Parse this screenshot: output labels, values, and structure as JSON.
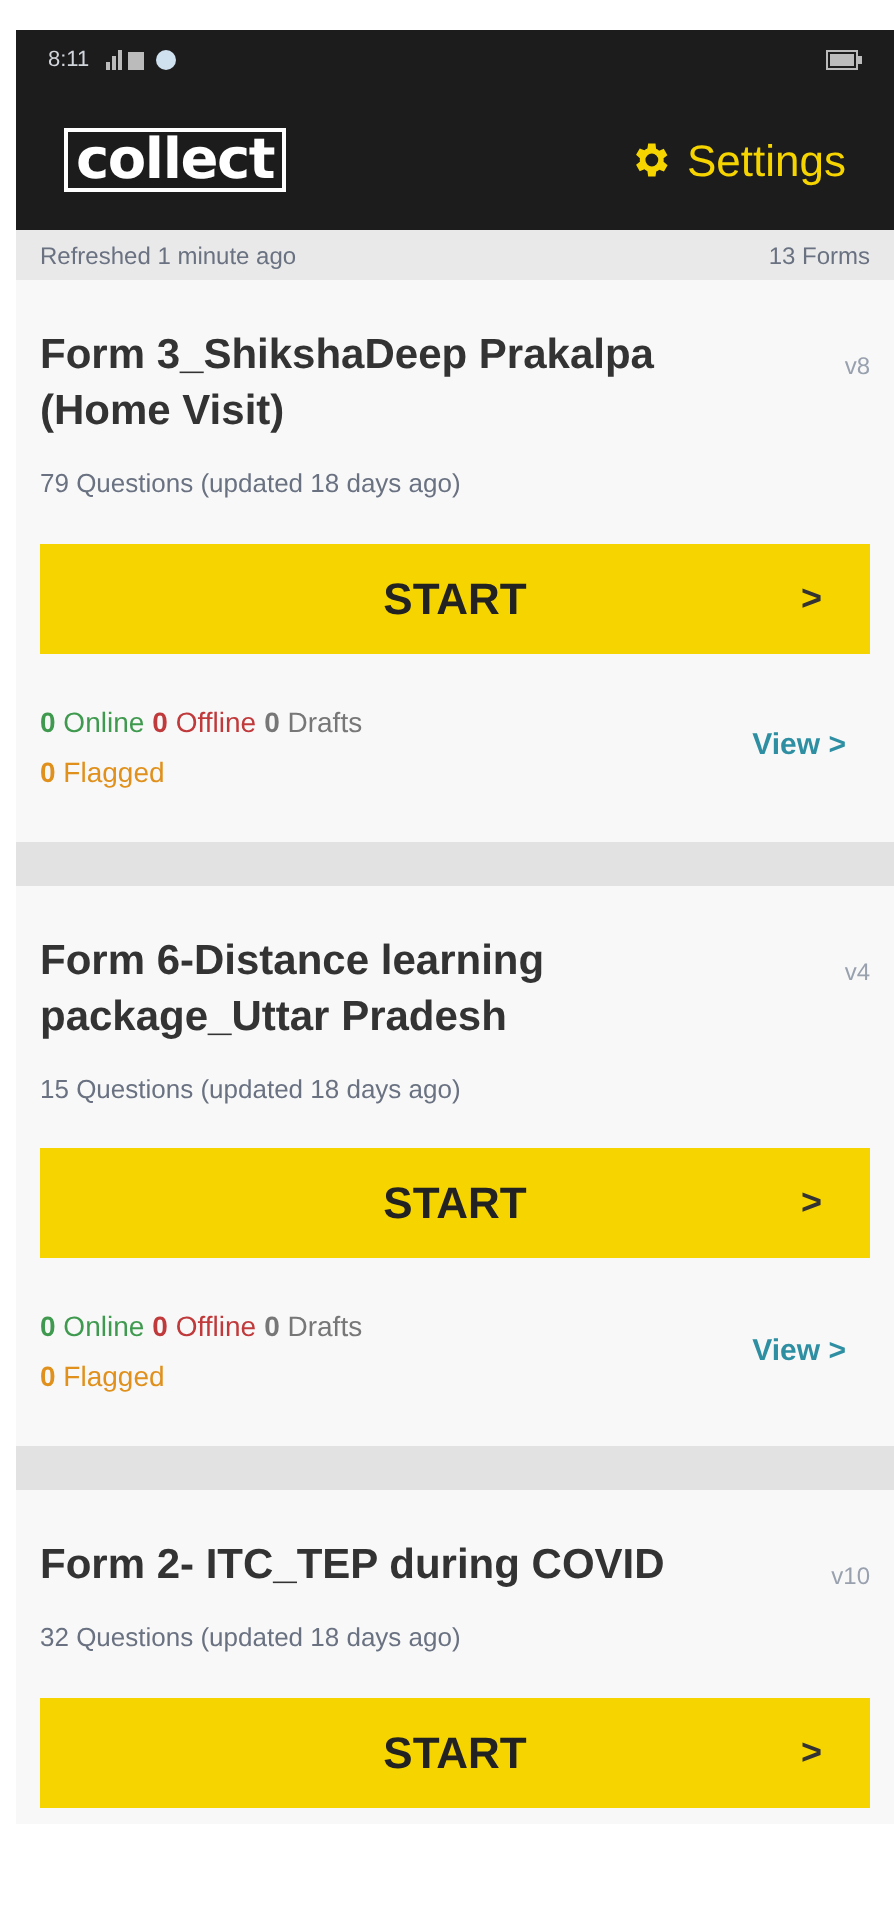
{
  "status_bar": {
    "time": "8:11"
  },
  "app_bar": {
    "logo": "collect",
    "settings": "Settings"
  },
  "list_header": {
    "refreshed": "Refreshed 1 minute ago",
    "count": "13 Forms"
  },
  "forms": [
    {
      "title": "Form 3_ShikshaDeep Prakalpa (Home Visit)",
      "version": "v8",
      "questions": "79 Questions (updated 18 days ago)",
      "start": "START",
      "chevron": ">",
      "counts": [
        {
          "kind": "online",
          "count": "0",
          "label": "Online"
        },
        {
          "kind": "offline",
          "count": "0",
          "label": "Offline"
        },
        {
          "kind": "drafts",
          "count": "0",
          "label": "Drafts"
        },
        {
          "kind": "flagged",
          "count": "0",
          "label": "Flagged"
        }
      ],
      "view": "View",
      "view_chevron": ">"
    },
    {
      "title": "Form 6-Distance learning package_Uttar Pradesh",
      "version": "v4",
      "questions": "15 Questions (updated 18 days ago)",
      "start": "START",
      "chevron": ">",
      "counts": [
        {
          "kind": "online",
          "count": "0",
          "label": "Online"
        },
        {
          "kind": "offline",
          "count": "0",
          "label": "Offline"
        },
        {
          "kind": "drafts",
          "count": "0",
          "label": "Drafts"
        },
        {
          "kind": "flagged",
          "count": "0",
          "label": "Flagged"
        }
      ],
      "view": "View",
      "view_chevron": ">"
    },
    {
      "title": "Form 2- ITC_TEP during COVID",
      "version": "v10",
      "questions": "32 Questions (updated 18 days ago)",
      "start": "START",
      "chevron": ">"
    }
  ]
}
